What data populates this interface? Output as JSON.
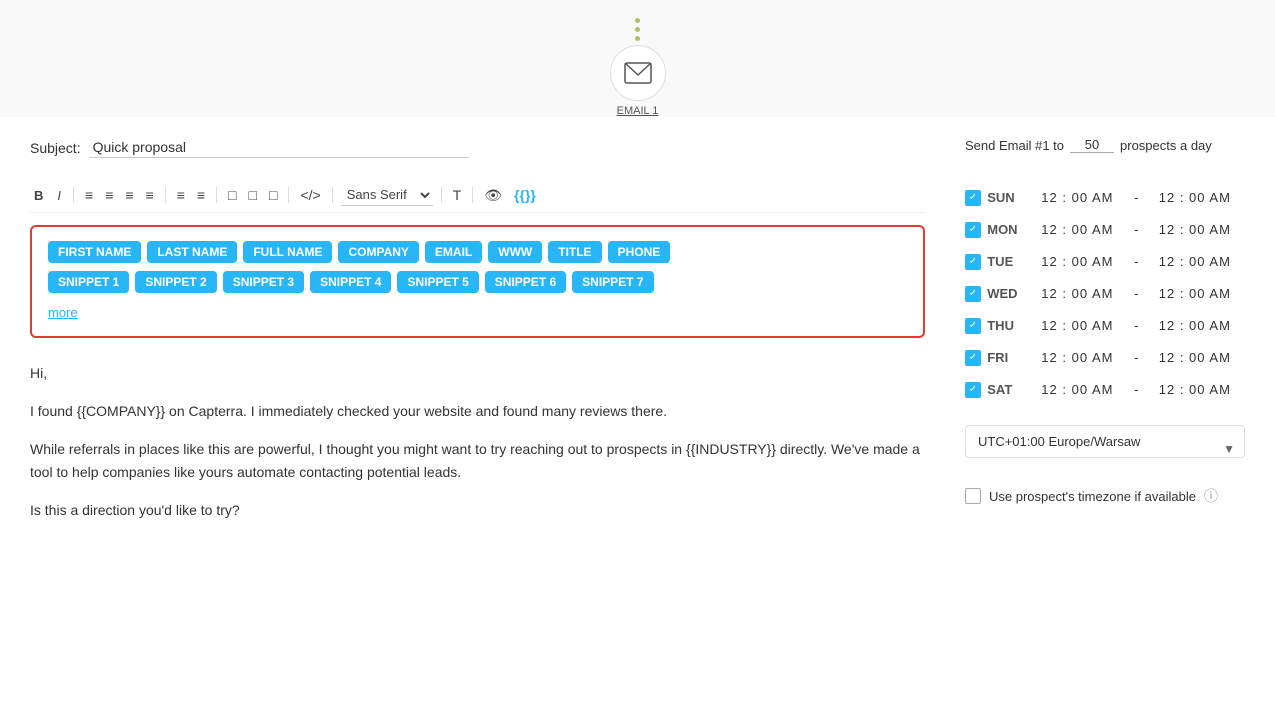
{
  "flow": {
    "dots_count": 3,
    "email_node_label": "EMAIL 1"
  },
  "subject": {
    "label": "Subject:",
    "value": "Quick proposal"
  },
  "toolbar": {
    "bold": "B",
    "italic": "I",
    "align_left": "≡",
    "align_center": "≡",
    "align_right": "≡",
    "align_justify": "≡",
    "list_ordered": "≡",
    "list_unordered": "≡",
    "image": "☐",
    "code": "</>",
    "font": "Sans Serif",
    "font_size": "T",
    "preview": "👁",
    "variables": "{{}}"
  },
  "snippets": {
    "row1": [
      "FIRST NAME",
      "LAST NAME",
      "FULL NAME",
      "COMPANY",
      "EMAIL",
      "WWW",
      "TITLE",
      "PHONE"
    ],
    "row2": [
      "SNIPPET 1",
      "SNIPPET 2",
      "SNIPPET 3",
      "SNIPPET 4",
      "SNIPPET 5",
      "SNIPPET 6",
      "SNIPPET 7"
    ],
    "more_label": "more"
  },
  "email_body": {
    "line1": "Hi,",
    "line2": "I found {{COMPANY}} on Capterra. I immediately checked your website and found many reviews there.",
    "line3": "While referrals in places like this are powerful, I thought you might want to try reaching out to prospects in {{INDUSTRY}} directly. We've made a tool to help companies like yours automate contacting potential leads.",
    "line4": "Is this a direction you'd like to try?"
  },
  "right_panel": {
    "send_prefix": "Send Email #1 to",
    "prospects_value": "50",
    "send_suffix": "prospects a day",
    "days": [
      {
        "key": "SUN",
        "checked": true
      },
      {
        "key": "MON",
        "checked": true
      },
      {
        "key": "TUE",
        "checked": true
      },
      {
        "key": "WED",
        "checked": true
      },
      {
        "key": "THU",
        "checked": true
      },
      {
        "key": "FRI",
        "checked": true
      },
      {
        "key": "SAT",
        "checked": true
      }
    ],
    "time_from": "12 : 00 AM",
    "time_to": "12 : 00 AM",
    "time_separator": "-",
    "timezone": "UTC+01:00 Europe/Warsaw",
    "prospect_tz_label": "Use prospect's timezone if available"
  }
}
